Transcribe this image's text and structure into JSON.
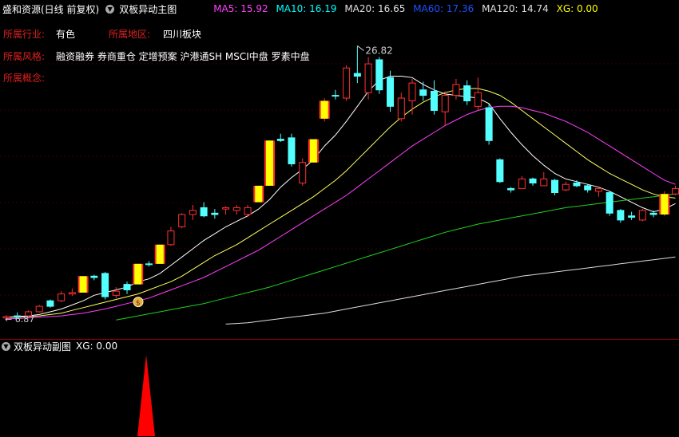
{
  "header": {
    "title": "盛和资源(日线 前复权)",
    "indicator_name": "双板异动主图",
    "ma": [
      {
        "label": "MA5: 15.92",
        "color": "#ff40ff"
      },
      {
        "label": "MA10: 16.19",
        "color": "#00ffff"
      },
      {
        "label": "MA20: 16.65",
        "color": "#e0e0e0"
      },
      {
        "label": "MA60: 17.36",
        "color": "#2050ff"
      },
      {
        "label": "MA120: 14.74",
        "color": "#e0e0e0"
      },
      {
        "label": "XG: 0.00",
        "color": "#ffff00"
      }
    ]
  },
  "info": {
    "industry_label": "所属行业:",
    "industry_value": "有色",
    "region_label": "所属地区:",
    "region_value": "四川板块",
    "style_label": "所属风格:",
    "style_value": "融资融券 券商重仓 定增预案 沪港通SH MSCI中盘 罗素中盘",
    "concept_label": "所属概念:"
  },
  "chart_data": {
    "type": "candlestick",
    "high_label": "26.82",
    "low_label": "6.87",
    "candles": [
      {
        "o": 6.95,
        "h": 7.15,
        "l": 6.9,
        "c": 7.05,
        "k": "u"
      },
      {
        "o": 7.0,
        "h": 7.35,
        "l": 6.95,
        "c": 7.1,
        "k": "d"
      },
      {
        "o": 7.1,
        "h": 7.5,
        "l": 7.0,
        "c": 7.4,
        "k": "u"
      },
      {
        "o": 7.4,
        "h": 7.9,
        "l": 7.35,
        "c": 7.8,
        "k": "u"
      },
      {
        "o": 7.8,
        "h": 8.3,
        "l": 7.7,
        "c": 8.2,
        "k": "d"
      },
      {
        "o": 8.2,
        "h": 8.9,
        "l": 8.1,
        "c": 8.7,
        "k": "u"
      },
      {
        "o": 8.7,
        "h": 9.1,
        "l": 8.55,
        "c": 8.8,
        "k": "u"
      },
      {
        "o": 8.8,
        "h": 10.0,
        "l": 8.8,
        "c": 10.0,
        "k": "z"
      },
      {
        "o": 10.0,
        "h": 10.1,
        "l": 9.7,
        "c": 9.9,
        "k": "d"
      },
      {
        "o": 10.2,
        "h": 10.3,
        "l": 8.3,
        "c": 8.5,
        "k": "d"
      },
      {
        "o": 8.6,
        "h": 9.2,
        "l": 8.4,
        "c": 8.9,
        "k": "u"
      },
      {
        "o": 9.0,
        "h": 9.6,
        "l": 8.7,
        "c": 9.4,
        "k": "d"
      },
      {
        "o": 9.4,
        "h": 10.9,
        "l": 9.4,
        "c": 10.9,
        "k": "z"
      },
      {
        "o": 10.9,
        "h": 11.1,
        "l": 10.7,
        "c": 10.9,
        "k": "d"
      },
      {
        "o": 10.9,
        "h": 12.3,
        "l": 10.9,
        "c": 12.3,
        "k": "z"
      },
      {
        "o": 12.3,
        "h": 13.6,
        "l": 12.2,
        "c": 13.3,
        "k": "u"
      },
      {
        "o": 13.6,
        "h": 14.6,
        "l": 13.5,
        "c": 14.5,
        "k": "u"
      },
      {
        "o": 14.5,
        "h": 15.2,
        "l": 14.1,
        "c": 14.8,
        "k": "u"
      },
      {
        "o": 15.0,
        "h": 15.4,
        "l": 14.3,
        "c": 14.4,
        "k": "d"
      },
      {
        "o": 14.5,
        "h": 14.9,
        "l": 14.2,
        "c": 14.6,
        "k": "d"
      },
      {
        "o": 14.9,
        "h": 15.1,
        "l": 14.5,
        "c": 15.0,
        "k": "u"
      },
      {
        "o": 15.0,
        "h": 15.2,
        "l": 14.5,
        "c": 14.8,
        "k": "u"
      },
      {
        "o": 14.5,
        "h": 15.2,
        "l": 14.3,
        "c": 15.0,
        "k": "u"
      },
      {
        "o": 15.4,
        "h": 16.6,
        "l": 15.4,
        "c": 16.6,
        "k": "z"
      },
      {
        "o": 16.6,
        "h": 19.9,
        "l": 16.6,
        "c": 19.9,
        "k": "z"
      },
      {
        "o": 19.9,
        "h": 20.4,
        "l": 19.8,
        "c": 20.0,
        "k": "d"
      },
      {
        "o": 20.1,
        "h": 20.4,
        "l": 18.0,
        "c": 18.2,
        "k": "d"
      },
      {
        "o": 16.8,
        "h": 18.6,
        "l": 16.6,
        "c": 18.3,
        "k": "u"
      },
      {
        "o": 18.3,
        "h": 20.0,
        "l": 18.3,
        "c": 20.0,
        "k": "z"
      },
      {
        "o": 21.5,
        "h": 23.0,
        "l": 21.3,
        "c": 22.8,
        "k": "z"
      },
      {
        "o": 23.2,
        "h": 23.6,
        "l": 22.9,
        "c": 23.2,
        "k": "d"
      },
      {
        "o": 23.0,
        "h": 25.4,
        "l": 22.8,
        "c": 25.2,
        "k": "u"
      },
      {
        "o": 24.8,
        "h": 26.82,
        "l": 24.1,
        "c": 24.6,
        "k": "d"
      },
      {
        "o": 23.4,
        "h": 26.0,
        "l": 22.9,
        "c": 25.5,
        "k": "u"
      },
      {
        "o": 25.8,
        "h": 26.0,
        "l": 23.3,
        "c": 23.6,
        "k": "d"
      },
      {
        "o": 24.5,
        "h": 25.0,
        "l": 22.0,
        "c": 22.4,
        "k": "d"
      },
      {
        "o": 21.5,
        "h": 23.4,
        "l": 21.3,
        "c": 23.0,
        "k": "u"
      },
      {
        "o": 22.8,
        "h": 24.4,
        "l": 21.8,
        "c": 24.1,
        "k": "u"
      },
      {
        "o": 23.6,
        "h": 24.2,
        "l": 22.8,
        "c": 23.2,
        "k": "d"
      },
      {
        "o": 23.5,
        "h": 24.3,
        "l": 21.8,
        "c": 22.1,
        "k": "d"
      },
      {
        "o": 22.0,
        "h": 23.5,
        "l": 21.0,
        "c": 23.2,
        "k": "u"
      },
      {
        "o": 23.2,
        "h": 24.4,
        "l": 22.9,
        "c": 24.0,
        "k": "u"
      },
      {
        "o": 23.9,
        "h": 24.3,
        "l": 22.5,
        "c": 22.8,
        "k": "d"
      },
      {
        "o": 23.4,
        "h": 24.5,
        "l": 22.1,
        "c": 22.4,
        "k": "u"
      },
      {
        "o": 22.3,
        "h": 22.6,
        "l": 19.6,
        "c": 19.9,
        "k": "d"
      },
      {
        "o": 18.5,
        "h": 18.6,
        "l": 16.8,
        "c": 16.9,
        "k": "d"
      },
      {
        "o": 16.4,
        "h": 16.5,
        "l": 16.1,
        "c": 16.3,
        "k": "d"
      },
      {
        "o": 16.4,
        "h": 17.3,
        "l": 16.4,
        "c": 17.1,
        "k": "u"
      },
      {
        "o": 17.1,
        "h": 17.2,
        "l": 16.6,
        "c": 16.8,
        "k": "d"
      },
      {
        "o": 16.6,
        "h": 17.6,
        "l": 16.6,
        "c": 17.1,
        "k": "u"
      },
      {
        "o": 17.0,
        "h": 17.1,
        "l": 15.9,
        "c": 16.1,
        "k": "d"
      },
      {
        "o": 16.3,
        "h": 16.9,
        "l": 16.2,
        "c": 16.7,
        "k": "u"
      },
      {
        "o": 16.8,
        "h": 17.0,
        "l": 16.5,
        "c": 16.6,
        "k": "d"
      },
      {
        "o": 16.6,
        "h": 16.7,
        "l": 16.1,
        "c": 16.3,
        "k": "d"
      },
      {
        "o": 16.4,
        "h": 16.5,
        "l": 15.8,
        "c": 16.2,
        "k": "u"
      },
      {
        "o": 16.1,
        "h": 16.2,
        "l": 14.4,
        "c": 14.6,
        "k": "d"
      },
      {
        "o": 14.8,
        "h": 14.9,
        "l": 13.9,
        "c": 14.1,
        "k": "d"
      },
      {
        "o": 14.3,
        "h": 14.7,
        "l": 14.1,
        "c": 14.4,
        "k": "d"
      },
      {
        "o": 14.1,
        "h": 14.9,
        "l": 14.0,
        "c": 14.8,
        "k": "u"
      },
      {
        "o": 14.6,
        "h": 14.8,
        "l": 14.3,
        "c": 14.5,
        "k": "d"
      },
      {
        "o": 14.5,
        "h": 16.2,
        "l": 14.4,
        "c": 16.0,
        "k": "z"
      },
      {
        "o": 16.0,
        "h": 16.6,
        "l": 15.9,
        "c": 16.4,
        "k": "u"
      }
    ],
    "ma_series": [
      {
        "name": "MA5",
        "color": "#ffffff",
        "values": [
          7.0,
          7.05,
          7.1,
          7.2,
          7.4,
          7.6,
          7.9,
          8.2,
          8.6,
          8.8,
          9.0,
          9.2,
          9.6,
          9.8,
          10.2,
          10.8,
          11.4,
          12.0,
          12.6,
          13.1,
          13.6,
          14.0,
          14.4,
          14.9,
          15.6,
          16.5,
          17.2,
          17.8,
          18.5,
          19.5,
          20.3,
          21.3,
          22.4,
          23.5,
          24.3,
          24.6,
          24.6,
          24.5,
          24.0,
          23.6,
          23.3,
          23.2,
          23.1,
          23.0,
          22.6,
          21.5,
          20.5,
          19.6,
          18.8,
          18.1,
          17.5,
          17.1,
          16.9,
          16.7,
          16.5,
          16.2,
          15.8,
          15.4,
          15.0,
          14.7,
          14.9,
          15.3
        ]
      },
      {
        "name": "MA10",
        "color": "#ffff60",
        "values": [
          7.0,
          7.0,
          7.05,
          7.1,
          7.2,
          7.3,
          7.5,
          7.7,
          7.9,
          8.1,
          8.3,
          8.5,
          8.7,
          9.0,
          9.3,
          9.6,
          10.0,
          10.5,
          11.0,
          11.5,
          11.9,
          12.3,
          12.8,
          13.3,
          13.8,
          14.3,
          14.8,
          15.3,
          15.8,
          16.4,
          17.0,
          17.7,
          18.5,
          19.3,
          20.1,
          20.9,
          21.6,
          22.2,
          22.7,
          23.1,
          23.4,
          23.6,
          23.7,
          23.7,
          23.5,
          23.2,
          22.7,
          22.1,
          21.5,
          20.9,
          20.3,
          19.7,
          19.1,
          18.5,
          18.0,
          17.5,
          17.1,
          16.7,
          16.3,
          16.0,
          15.8,
          15.7
        ]
      },
      {
        "name": "MA20",
        "color": "#ff40ff",
        "values": [
          6.9,
          6.9,
          6.95,
          7.0,
          7.05,
          7.1,
          7.2,
          7.3,
          7.45,
          7.6,
          7.8,
          8.0,
          8.2,
          8.4,
          8.7,
          9.0,
          9.3,
          9.6,
          9.9,
          10.3,
          10.7,
          11.1,
          11.5,
          11.9,
          12.4,
          12.9,
          13.4,
          13.9,
          14.4,
          14.9,
          15.4,
          15.9,
          16.5,
          17.1,
          17.7,
          18.3,
          18.9,
          19.5,
          20.0,
          20.5,
          21.0,
          21.4,
          21.8,
          22.1,
          22.3,
          22.4,
          22.4,
          22.3,
          22.1,
          21.9,
          21.6,
          21.3,
          20.9,
          20.5,
          20.0,
          19.5,
          19.0,
          18.5,
          18.0,
          17.5,
          17.0,
          16.7
        ]
      },
      {
        "name": "MA60",
        "color": "#20d020",
        "start": 10,
        "values": [
          6.8,
          6.95,
          7.1,
          7.25,
          7.4,
          7.55,
          7.7,
          7.85,
          8.0,
          8.2,
          8.4,
          8.6,
          8.8,
          9.0,
          9.2,
          9.45,
          9.7,
          9.95,
          10.2,
          10.45,
          10.7,
          10.95,
          11.2,
          11.45,
          11.7,
          11.95,
          12.2,
          12.45,
          12.7,
          12.95,
          13.2,
          13.4,
          13.6,
          13.8,
          13.95,
          14.1,
          14.25,
          14.4,
          14.55,
          14.7,
          14.85,
          15.0,
          15.1,
          15.2,
          15.3,
          15.4,
          15.5,
          15.6,
          15.7,
          15.8,
          15.9,
          16.0
        ]
      },
      {
        "name": "MA120",
        "color": "#dddddd",
        "start": 20,
        "values": [
          6.5,
          6.55,
          6.6,
          6.7,
          6.8,
          6.9,
          7.0,
          7.1,
          7.2,
          7.3,
          7.45,
          7.6,
          7.75,
          7.9,
          8.05,
          8.2,
          8.35,
          8.5,
          8.65,
          8.8,
          8.95,
          9.1,
          9.25,
          9.4,
          9.55,
          9.7,
          9.85,
          10.0,
          10.1,
          10.2,
          10.3,
          10.4,
          10.5,
          10.6,
          10.7,
          10.8,
          10.9,
          11.0,
          11.1,
          11.2,
          11.3,
          11.4
        ]
      }
    ],
    "marker_index": 11,
    "xg_signal_index": 12,
    "price_min": 6.0,
    "price_max": 28.3
  },
  "sub": {
    "indicator_name": "双板异动副图",
    "xg_label": "XG: 0.00"
  }
}
